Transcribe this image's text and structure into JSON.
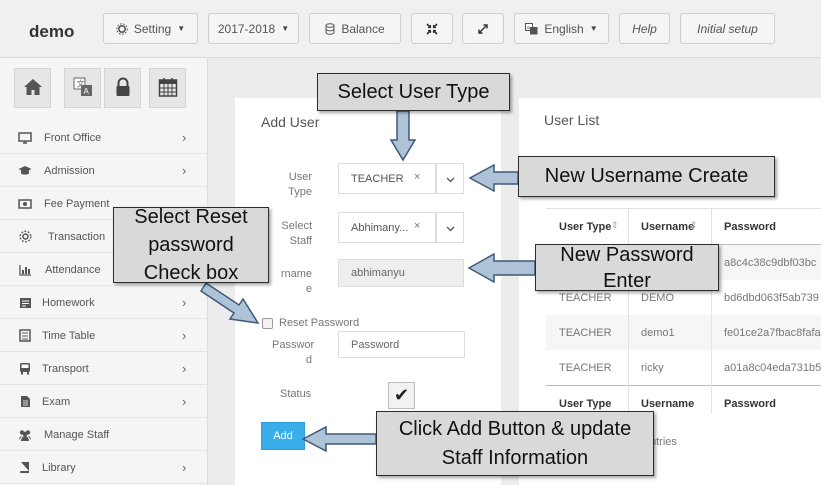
{
  "app": {
    "brand": "demo"
  },
  "toolbar": {
    "setting_label": "Setting",
    "session_label": "2017-2018",
    "balance_label": "Balance",
    "language_label": "English",
    "help_label": "Help",
    "initial_setup_label": "Initial setup"
  },
  "sidebar": {
    "quick_icons": [
      "home-icon",
      "translate-icon",
      "lock-icon",
      "calendar-icon"
    ],
    "items": [
      {
        "label": "Front Office",
        "icon": "monitor-icon",
        "chevron": "›"
      },
      {
        "label": "Admission",
        "icon": "graduation-cap-icon",
        "chevron": "›"
      },
      {
        "label": "Fee Payment",
        "icon": "money-icon",
        "chevron": ""
      },
      {
        "label": "Transaction",
        "icon": "gear-icon",
        "chevron": ""
      },
      {
        "label": "Attendance",
        "icon": "bar-chart-icon",
        "chevron": ""
      },
      {
        "label": "Homework",
        "icon": "homework-icon",
        "chevron": "›"
      },
      {
        "label": "Time Table",
        "icon": "timetable-icon",
        "chevron": "›"
      },
      {
        "label": "Transport",
        "icon": "bus-icon",
        "chevron": "›"
      },
      {
        "label": "Exam",
        "icon": "document-icon",
        "chevron": "›"
      },
      {
        "label": "Manage Staff",
        "icon": "users-icon",
        "chevron": ""
      },
      {
        "label": "Library",
        "icon": "book-icon",
        "chevron": "›"
      }
    ]
  },
  "add_user": {
    "title": "Add User",
    "user_type_label_1": "User",
    "user_type_label_2": "Type",
    "user_type_value": "TEACHER",
    "select_staff_label_1": "Select",
    "select_staff_label_2": "Staff",
    "select_staff_value": "Abhimany...",
    "username_label_1": "rname",
    "username_label_2": "e",
    "username_value": "abhimanyu",
    "reset_password_label": "Reset Password",
    "password_label_1": "Passwor",
    "password_label_2": "d",
    "password_placeholder": "Password",
    "status_label": "Status",
    "status_checked_mark": "✔",
    "clear_mark": "×",
    "add_button_label": "Add"
  },
  "user_list": {
    "title": "User List",
    "columns": [
      "User Type",
      "Username",
      "Password"
    ],
    "rows": [
      [
        "",
        "",
        "a8c4c38c9dbf03bc"
      ],
      [
        "TEACHER",
        "DEMO",
        "bd6dbd063f5ab739"
      ],
      [
        "TEACHER",
        "demo1",
        "fe01ce2a7fbac8fafa"
      ],
      [
        "TEACHER",
        "ricky",
        "a01a8c04eda731b5"
      ]
    ],
    "footer_columns": [
      "User Type",
      "Username",
      "Password"
    ],
    "entries_fragment": "ntries"
  },
  "callouts": {
    "select_user_type": "Select User Type",
    "new_username": "New Username Create",
    "select_reset_1": "Select Reset",
    "select_reset_2": "password",
    "select_reset_3": "Check box",
    "new_password_1": "New Password",
    "new_password_2": "Enter",
    "click_add_1": "Click Add Button & update",
    "click_add_2": "Staff  Information"
  },
  "colors": {
    "accent_blue": "#3aaee8",
    "callout_bg": "#d9d9d9",
    "arrow_fill": "#aec3d8",
    "arrow_stroke": "#3f5a78"
  }
}
